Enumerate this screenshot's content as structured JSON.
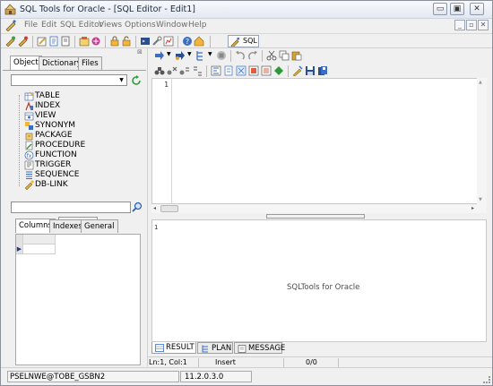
{
  "window": {
    "title": "SQL Tools for Oracle - [SQL Editor - Edit1]",
    "controls": {
      "minimize": "▭",
      "maximize": "▣",
      "close": "✕"
    }
  },
  "menu": {
    "items": [
      "File",
      "Edit",
      "SQL Editor",
      "Views",
      "Options",
      "Window",
      "Help"
    ],
    "mdi_controls": {
      "minimize": "_",
      "restore": "▫",
      "close": "✕"
    }
  },
  "toolbar": {
    "sql_button_label": "SQL"
  },
  "object_browser": {
    "tabs": [
      "Object",
      "Dictionary",
      "Files"
    ],
    "schema_combo_value": "",
    "tree_items": [
      "TABLE",
      "INDEX",
      "VIEW",
      "SYNONYM",
      "PACKAGE",
      "PROCEDURE",
      "FUNCTION",
      "TRIGGER",
      "SEQUENCE",
      "DB-LINK"
    ],
    "filter_value": "",
    "detail_tabs": [
      "Columns",
      "Indexes",
      "General"
    ]
  },
  "editor": {
    "line_numbers": [
      "1"
    ]
  },
  "result_panel": {
    "row_marker": "1",
    "placeholder_text": "SQLTools for Oracle",
    "tabs": [
      "RESULT",
      "PLAN",
      "MESSAGE"
    ]
  },
  "status": {
    "cursor_position": "Ln:1, Col:1",
    "insert_mode": "Insert",
    "row_count": "0/0",
    "connection": "PSELNWE@TOBE_GSBN2",
    "version": "11.2.0.3.0"
  },
  "colors": {
    "window_bg": "#f0f0f0",
    "editor_bg": "#ffffff",
    "accent": "#233b78"
  }
}
